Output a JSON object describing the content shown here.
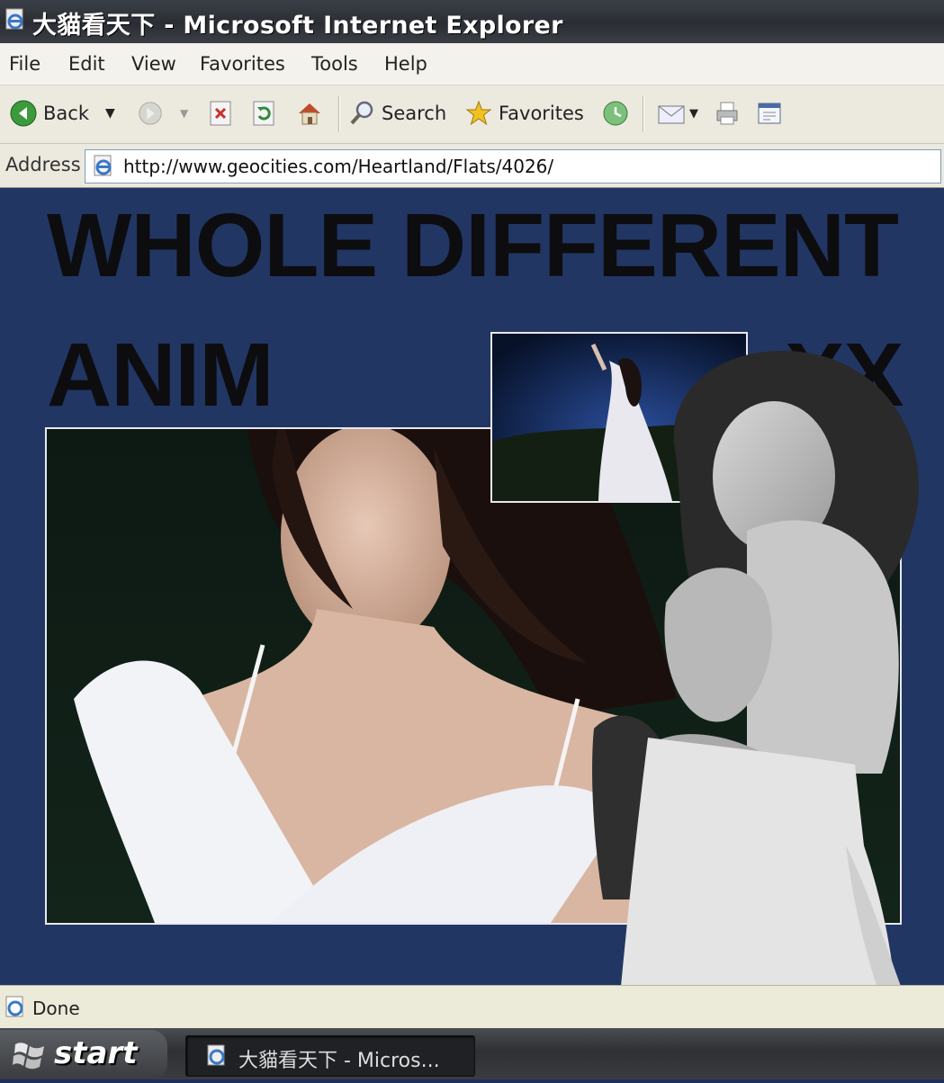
{
  "window": {
    "title": "大貓看天下 - Microsoft Internet Explorer"
  },
  "menu": [
    "File",
    "Edit",
    "View",
    "Favorites",
    "Tools",
    "Help"
  ],
  "toolbar": {
    "back_label": "Back",
    "search_label": "Search",
    "favorites_label": "Favorites",
    "icons": [
      "back-icon",
      "forward-icon",
      "stop-icon",
      "refresh-icon",
      "home-icon",
      "search-icon",
      "favorites-icon",
      "history-icon",
      "mail-icon",
      "print-icon",
      "edit-icon"
    ]
  },
  "address": {
    "label": "Address",
    "url": "http://www.geocities.com/Heartland/Flats/4026/"
  },
  "page": {
    "headline_line1": "WHOLE DIFFERENT",
    "headline_line2_left": "ANIM",
    "headline_line2_right": "XX"
  },
  "status": {
    "text": "Done"
  },
  "taskbar": {
    "start_label": "start",
    "item_label": "大貓看天下 - Micros..."
  },
  "colors": {
    "page_background": "#223663",
    "headline": "#0d0d10",
    "photo_border": "#e8e8ee"
  }
}
